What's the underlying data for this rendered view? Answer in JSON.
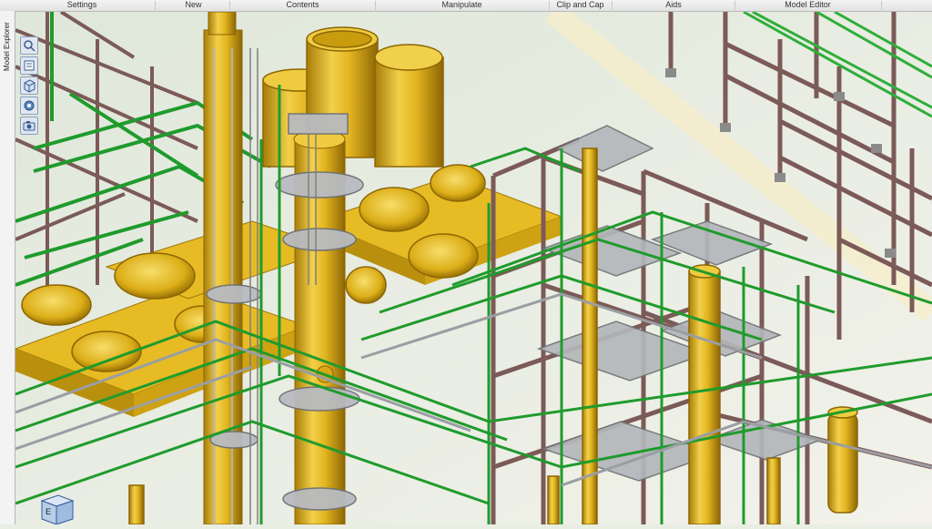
{
  "ribbon": {
    "groups": [
      "Settings",
      "New",
      "Contents",
      "Manipulate",
      "Clip and Cap",
      "Aids",
      "Model Editor"
    ]
  },
  "side_panel": {
    "tab_label": "Model Explorer"
  },
  "toolstrip": {
    "icons": [
      "zoom-icon",
      "select-icon",
      "box-icon",
      "measure-icon",
      "camera-icon"
    ]
  },
  "nav_cube": {
    "face_label": "E"
  },
  "colors": {
    "steel": "#7b5a57",
    "pipe": "#1f9b2c",
    "vessel": "#e2b51a",
    "platform": "#a9acb0",
    "ground": "#e8eddf"
  }
}
